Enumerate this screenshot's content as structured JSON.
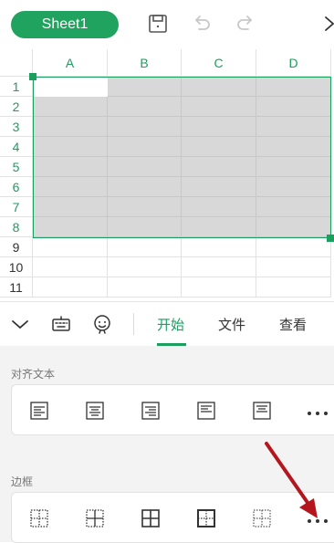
{
  "toolbar": {
    "sheet_tab_label": "Sheet1",
    "icons": [
      "save-icon",
      "undo-icon",
      "redo-icon",
      "close-icon"
    ]
  },
  "grid": {
    "columns": [
      "A",
      "B",
      "C",
      "D"
    ],
    "rows": [
      "1",
      "2",
      "3",
      "4",
      "5",
      "6",
      "7",
      "8",
      "9",
      "10",
      "11"
    ],
    "selected_range": "A1:D8",
    "accent_color": "#1a9f5f",
    "selection_fill": "#d8d8d8"
  },
  "tabs": {
    "icons": [
      "chevron-down-icon",
      "keyboard-icon",
      "emoji-icon"
    ],
    "items": [
      {
        "label": "开始",
        "active": true
      },
      {
        "label": "文件",
        "active": false
      },
      {
        "label": "查看",
        "active": false
      }
    ]
  },
  "sections": {
    "align_title": "对齐文本",
    "border_title": "边框",
    "align_tools": [
      "align-left-icon",
      "align-center-icon",
      "align-right-icon",
      "align-top-icon",
      "align-middle-icon",
      "more-icon"
    ],
    "border_tools": [
      "border-outer-dashed-icon",
      "border-inner-icon",
      "border-all-icon",
      "border-outside-thick-icon",
      "border-none-icon",
      "more-icon"
    ]
  },
  "colors": {
    "brand_green": "#1fa35f",
    "annotation_arrow": "#b3171d"
  }
}
